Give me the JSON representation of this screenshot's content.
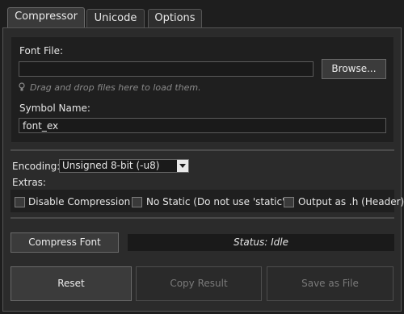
{
  "tabs": [
    {
      "label": "Compressor"
    },
    {
      "label": "Unicode"
    },
    {
      "label": "Options"
    }
  ],
  "font_file": {
    "label": "Font File:",
    "value": "",
    "browse_label": "Browse...",
    "hint": "Drag and drop files here to load them.",
    "hint_icon": "lightbulb-icon"
  },
  "symbol_name": {
    "label": "Symbol Name:",
    "value": "font_ex"
  },
  "encoding": {
    "label": "Encoding:",
    "selected": "Unsigned 8-bit (-u8)"
  },
  "extras": {
    "label": "Extras:",
    "options": [
      {
        "label": "Disable Compression",
        "checked": false
      },
      {
        "label": "No Static (Do not use 'static')",
        "checked": false
      },
      {
        "label": "Output as .h (Header)",
        "checked": false
      }
    ]
  },
  "compress": {
    "button_label": "Compress Font",
    "status": "Status: Idle"
  },
  "actions": {
    "reset_label": "Reset",
    "copy_label": "Copy Result",
    "save_label": "Save as File"
  },
  "colors": {
    "background": "#1e1e1e",
    "panel": "#2b2b2b",
    "disabled_text": "#7a7a7a"
  }
}
